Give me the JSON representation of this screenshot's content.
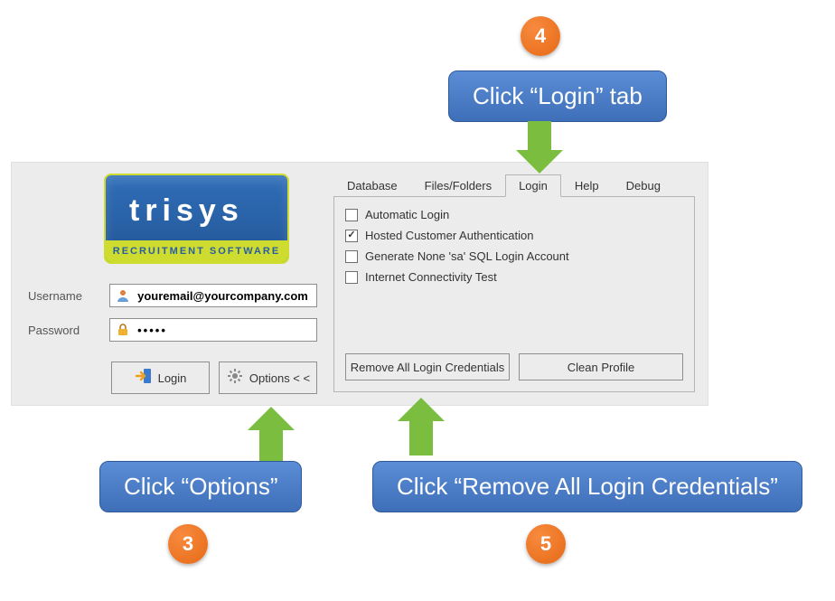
{
  "logo": {
    "brand": "trisys",
    "subtitle": "RECRUITMENT SOFTWARE"
  },
  "fields": {
    "username_label": "Username",
    "username_value": "youremail@yourcompany.com",
    "password_label": "Password",
    "password_value": "•••••"
  },
  "buttons": {
    "login": "Login",
    "options": "Options < <"
  },
  "tabs": {
    "database": "Database",
    "files": "Files/Folders",
    "login": "Login",
    "help": "Help",
    "debug": "Debug"
  },
  "login_tab": {
    "auto": {
      "label": "Automatic Login",
      "checked": false
    },
    "hosted": {
      "label": "Hosted Customer Authentication",
      "checked": true
    },
    "nonesa": {
      "label": "Generate None 'sa' SQL Login Account",
      "checked": false
    },
    "nettest": {
      "label": "Internet Connectivity Test",
      "checked": false
    },
    "remove": "Remove All Login Credentials",
    "clean": "Clean Profile"
  },
  "callouts": {
    "step4": {
      "num": "4",
      "text": "Click “Login” tab"
    },
    "step3": {
      "num": "3",
      "text": "Click “Options”"
    },
    "step5": {
      "num": "5",
      "text": "Click “Remove All Login Credentials”"
    }
  }
}
